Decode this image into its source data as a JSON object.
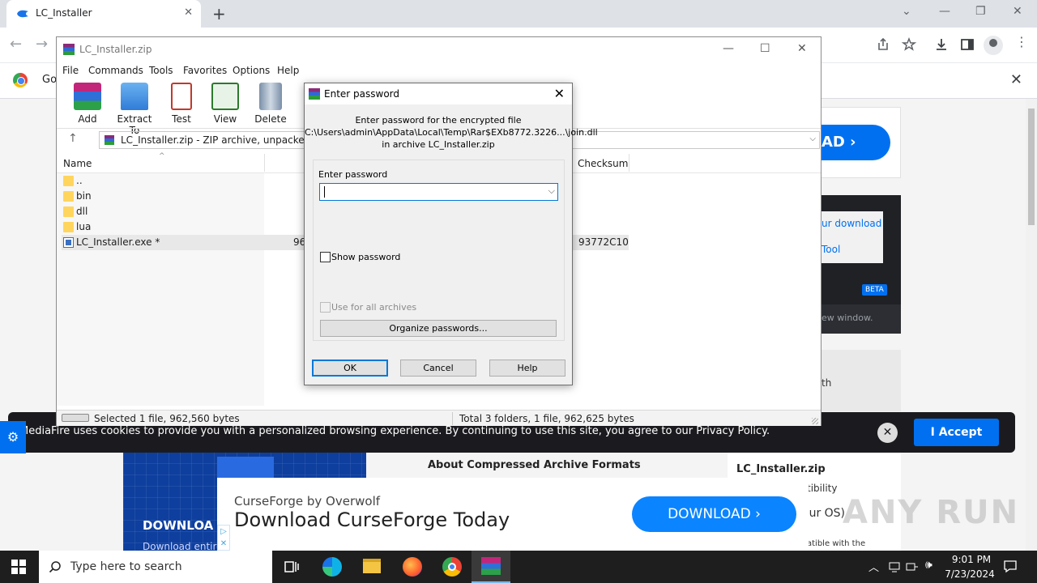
{
  "browser": {
    "tab_title": "LC_Installer",
    "tab_close": "✕",
    "new_tab": "+",
    "window_controls": [
      "⌄",
      "—",
      "❐",
      "✕"
    ],
    "back": "←",
    "forward": "→",
    "toolbar_icons": [
      "share-icon",
      "star-icon",
      "download-icon",
      "sidebar-icon",
      "profile-icon",
      "menu-icon"
    ],
    "infobar_text": "Go",
    "infobar_close": "✕"
  },
  "winrar": {
    "title": "LC_Installer.zip",
    "window_controls": [
      "—",
      "☐",
      "✕"
    ],
    "menu": [
      "File",
      "Commands",
      "Tools",
      "Favorites",
      "Options",
      "Help"
    ],
    "tools": [
      "Add",
      "Extract To",
      "Test",
      "View",
      "Delete"
    ],
    "path": "LC_Installer.zip - ZIP archive, unpacked size",
    "columns": {
      "name": "Name",
      "checksum": "Checksum"
    },
    "files": [
      {
        "name": "..",
        "type": "folder",
        "size": "",
        "checksum": ""
      },
      {
        "name": "bin",
        "type": "folder",
        "size": "",
        "checksum": ""
      },
      {
        "name": "dll",
        "type": "folder",
        "size": "",
        "checksum": ""
      },
      {
        "name": "lua",
        "type": "folder",
        "size": "",
        "checksum": ""
      },
      {
        "name": "LC_Installer.exe *",
        "type": "exe",
        "size": "96",
        "checksum": "93772C10"
      }
    ],
    "status_left": "Selected 1 file, 962,560 bytes",
    "status_right": "Total 3 folders, 1 file, 962,625 bytes"
  },
  "dialog": {
    "title": "Enter password",
    "message_line1": "Enter password for the encrypted file",
    "message_line2": "C:\\Users\\admin\\AppData\\Local\\Temp\\Rar$EXb8772.3226...\\join.dll",
    "message_line3": "in archive LC_Installer.zip",
    "password_label": "Enter password",
    "password_value": "",
    "show_password": "Show password",
    "use_for_all": "Use for all archives",
    "organize": "Organize passwords...",
    "ok": "OK",
    "cancel": "Cancel",
    "help": "Help"
  },
  "page": {
    "download_label": "AD",
    "panel_link1": "ur download",
    "panel_link2": "Tool",
    "beta": "BETA",
    "panel_sub": "ew window.",
    "gray_text": "th",
    "promo_title": "DOWNLOA",
    "promo_sub": "Download entire",
    "about_title": "About Compressed Archive Formats",
    "file_name": "LC_Installer.zip",
    "compat": "tibility",
    "os": "our OS)",
    "os2": "atible with the",
    "watermark": "ANY RUN"
  },
  "cookie": {
    "text": "MediaFire uses cookies to provide you with a personalized browsing experience. By continuing to use this site, you agree to our Privacy Policy.",
    "close": "✕",
    "accept": "I Accept"
  },
  "ad": {
    "brand": "CurseForge by Overwolf",
    "headline": "Download CurseForge Today",
    "button": "DOWNLOAD"
  },
  "taskbar": {
    "search_placeholder": "Type here to search",
    "time": "9:01 PM",
    "date": "7/23/2024"
  },
  "colors": {
    "accent": "#0070f0",
    "taskbar": "#1e1e1e",
    "dialog_bg": "#f0f0f0"
  }
}
